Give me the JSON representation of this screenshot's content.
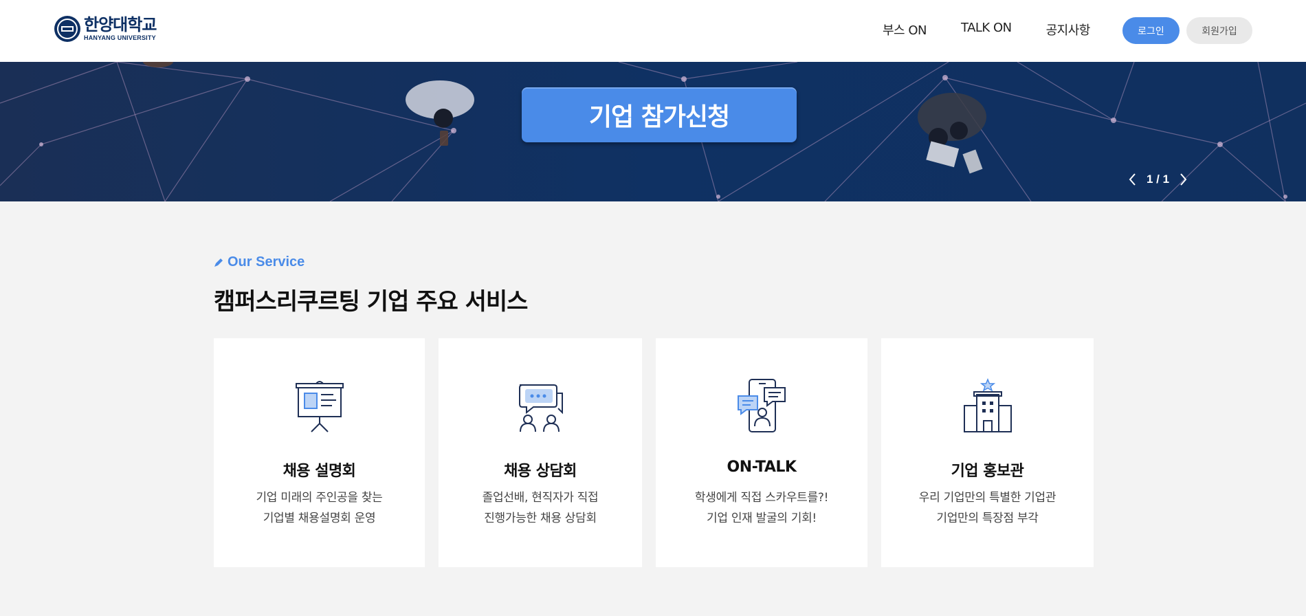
{
  "header": {
    "logo": {
      "name_ko": "한양대학교",
      "name_en": "HANYANG UNIVERSITY"
    },
    "nav": [
      "부스 ON",
      "TALK ON",
      "공지사항"
    ],
    "login_label": "로그인",
    "join_label": "회원가입"
  },
  "banner": {
    "cta_label": "기업 참가신청",
    "pager": "1 / 1"
  },
  "services": {
    "eyebrow": "Our Service",
    "title": "캠퍼스리쿠르팅 기업 주요 서비스",
    "cards": [
      {
        "title": "채용 설명회",
        "desc1": "기업 미래의 주인공을 찾는",
        "desc2": "기업별 채용설명회 운영",
        "icon": "presentation-board-icon"
      },
      {
        "title": "채용 상담회",
        "desc1": "졸업선배, 현직자가 직접",
        "desc2": "진행가능한 채용 상담회",
        "icon": "consultation-chat-icon"
      },
      {
        "title": "ON-TALK",
        "desc1": "학생에게 직접 스카우트를?!",
        "desc2": "기업 인재 발굴의 기회!",
        "icon": "mobile-chat-icon"
      },
      {
        "title": "기업 홍보관",
        "desc1": "우리 기업만의 특별한 기업관",
        "desc2": "기업만의 특장점 부각",
        "icon": "company-building-icon"
      }
    ]
  },
  "colors": {
    "accent": "#4a8be8",
    "banner_bg": "#0f3163",
    "page_bg": "#f3f3f3",
    "icon_navy": "#1e2f55"
  }
}
